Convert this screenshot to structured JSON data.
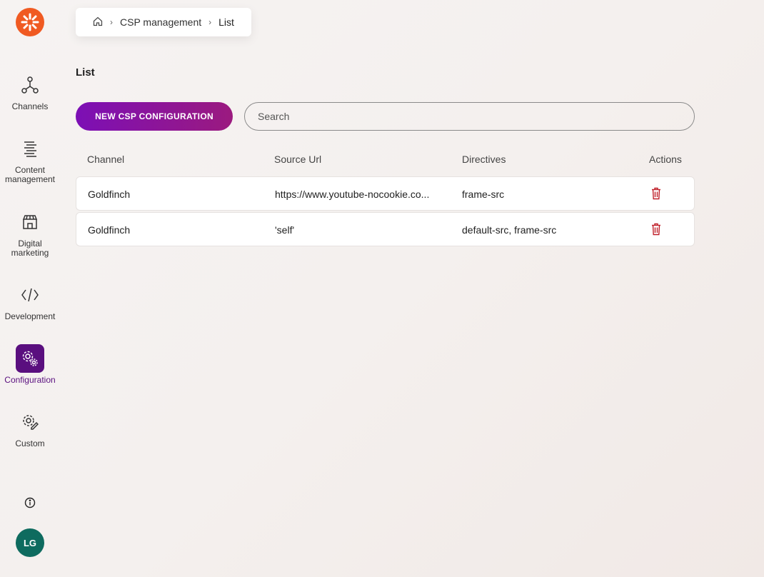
{
  "sidebar": {
    "items": [
      {
        "label": "Channels",
        "icon": "channels-icon"
      },
      {
        "label": "Content management",
        "icon": "content-management-icon"
      },
      {
        "label": "Digital marketing",
        "icon": "storefront-icon"
      },
      {
        "label": "Development",
        "icon": "code-icon"
      },
      {
        "label": "Configuration",
        "icon": "gears-icon",
        "active": true
      },
      {
        "label": "Custom",
        "icon": "custom-gear-icon"
      }
    ],
    "avatar": "LG"
  },
  "breadcrumb": {
    "home_icon": "home-icon",
    "section": "CSP management",
    "current": "List"
  },
  "page": {
    "title": "List",
    "new_button": "NEW CSP CONFIGURATION",
    "search_placeholder": "Search"
  },
  "table": {
    "headers": {
      "channel": "Channel",
      "source_url": "Source Url",
      "directives": "Directives",
      "actions": "Actions"
    },
    "rows": [
      {
        "channel": "Goldfinch",
        "source_url": "https://www.youtube-nocookie.co...",
        "directives": "frame-src"
      },
      {
        "channel": "Goldfinch",
        "source_url": "'self'",
        "directives": "default-src, frame-src"
      }
    ]
  },
  "colors": {
    "accent": "#5a0f7f",
    "logo": "#f05a22",
    "avatar": "#0e6b5f",
    "delete": "#c0202a"
  }
}
